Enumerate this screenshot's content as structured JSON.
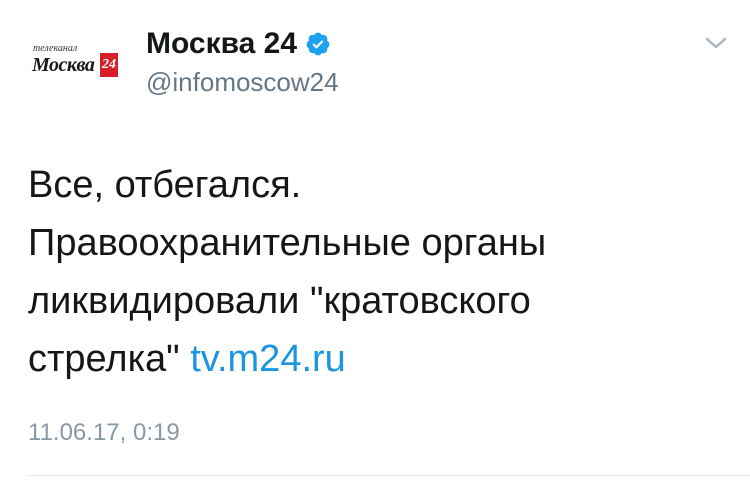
{
  "author": {
    "avatar": {
      "small_text": "телеканал",
      "brand_text": "Москва",
      "brand_number": "24",
      "brand_color": "#d61f26"
    },
    "display_name": "Москва 24",
    "verified": true,
    "verified_icon": "verified-badge-icon",
    "handle": "@infomoscow24"
  },
  "menu_icon": "chevron-down-icon",
  "tweet": {
    "lines": [
      "Все, отбегался.",
      "Правоохранительные органы",
      "ликвидировали \"кратовского"
    ],
    "last_line_text": "стрелка\" ",
    "link_text": "tv.m24.ru",
    "timestamp": "11.06.17, 0:19"
  },
  "colors": {
    "link": "#1b95e0",
    "verified": "#1da1f2",
    "secondary_text": "#657786",
    "timestamp": "#8899a6"
  }
}
